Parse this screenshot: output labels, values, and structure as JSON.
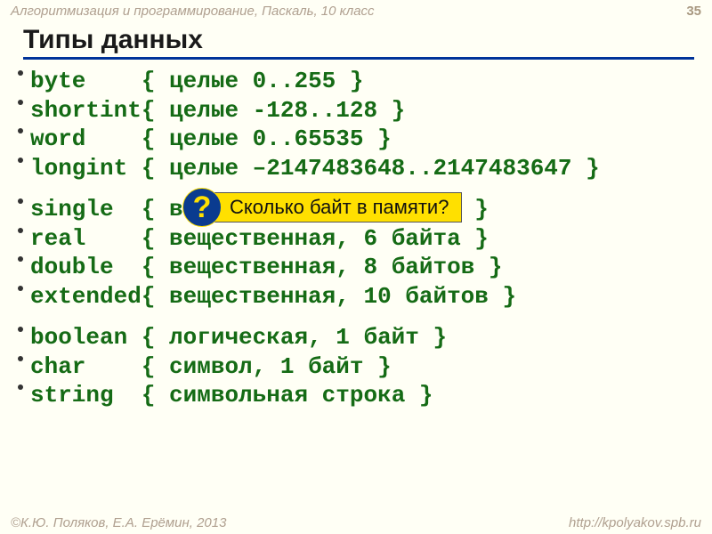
{
  "header": {
    "course": "Алгоритмизация и программирование, Паскаль, 10 класс",
    "page": "35"
  },
  "title": "Типы данных",
  "rows": [
    {
      "kw": "byte",
      "pad": "    ",
      "comment": "{ целые 0..255 }"
    },
    {
      "kw": "shortint",
      "pad": "",
      "comment": "{ целые -128..128 }"
    },
    {
      "kw": "word",
      "pad": "    ",
      "comment": "{ целые 0..65535 }"
    },
    {
      "kw": "longint",
      "pad": " ",
      "comment": "{ целые –2147483648..2147483647 }"
    }
  ],
  "rows2": [
    {
      "kw": "single",
      "pad": "  ",
      "comment": "{ вещественная, 4 байта }"
    },
    {
      "kw": "real",
      "pad": "    ",
      "comment": "{ вещественная, 6 байта }"
    },
    {
      "kw": "double",
      "pad": "  ",
      "comment": "{ вещественная, 8 байтов }"
    },
    {
      "kw": "extended",
      "pad": "",
      "comment": "{ вещественная, 10 байтов }"
    }
  ],
  "rows3": [
    {
      "kw": "boolean",
      "pad": " ",
      "comment": "{ логическая, 1 байт }"
    },
    {
      "kw": "char",
      "pad": "    ",
      "comment": "{ символ, 1 байт }"
    },
    {
      "kw": "string",
      "pad": "  ",
      "comment": "{ символьная строка }"
    }
  ],
  "callout": {
    "mark": "?",
    "text": "Сколько байт в памяти?"
  },
  "footer": {
    "copyright": "©К.Ю. Поляков, Е.А. Ерёмин, 2013",
    "url": "http://kpolyakov.spb.ru"
  }
}
